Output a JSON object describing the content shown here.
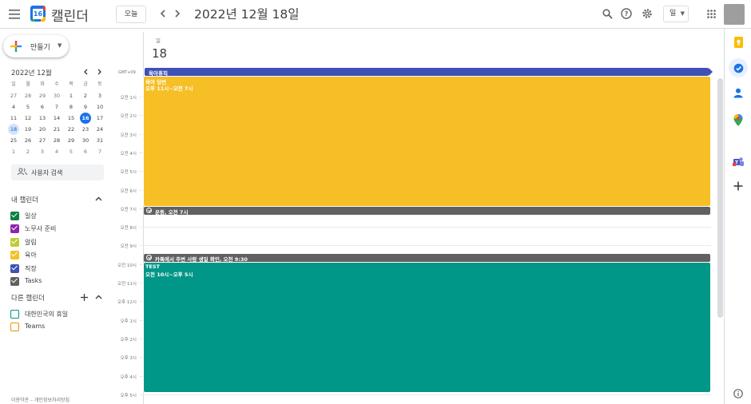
{
  "header": {
    "app_title": "캘린더",
    "logo_day": "16",
    "today_button": "오늘",
    "date_title": "2022년 12월 18일",
    "view_select": "일"
  },
  "sidebar": {
    "create_label": "만들기",
    "mini_calendar": {
      "title": "2022년 12월",
      "weekdays": [
        "일",
        "월",
        "화",
        "수",
        "목",
        "금",
        "토"
      ],
      "weeks": [
        [
          "27",
          "28",
          "29",
          "30",
          "1",
          "2",
          "3"
        ],
        [
          "4",
          "5",
          "6",
          "7",
          "8",
          "9",
          "10"
        ],
        [
          "11",
          "12",
          "13",
          "14",
          "15",
          "16",
          "17"
        ],
        [
          "18",
          "19",
          "20",
          "21",
          "22",
          "23",
          "24"
        ],
        [
          "25",
          "26",
          "27",
          "28",
          "29",
          "30",
          "31"
        ],
        [
          "1",
          "2",
          "3",
          "4",
          "5",
          "6",
          "7"
        ]
      ],
      "today": "16",
      "selected": "18"
    },
    "search_users": "사용자 검색",
    "my_calendars_title": "내 캘린더",
    "my_calendars": [
      {
        "label": "일상",
        "color": "#0b8043"
      },
      {
        "label": "노무사 준비",
        "color": "#8e24aa"
      },
      {
        "label": "알림",
        "color": "#c0ca33"
      },
      {
        "label": "육아",
        "color": "#f6bf26"
      },
      {
        "label": "직장",
        "color": "#3f51b5"
      },
      {
        "label": "Tasks",
        "color": "#616161"
      }
    ],
    "other_calendars_title": "다른 캘린더",
    "other_calendars": [
      {
        "label": "대한민국의 휴일",
        "color": "#009688"
      },
      {
        "label": "Teams",
        "color": "#f09300"
      }
    ],
    "footer": "이용약관 – 개인정보처리방침"
  },
  "day_view": {
    "day_name": "일",
    "day_number": "18",
    "timezone": "GMT+09",
    "hours": [
      "오전 1시",
      "오전 2시",
      "오전 3시",
      "오전 4시",
      "오전 5시",
      "오전 6시",
      "오전 7시",
      "오전 8시",
      "오전 9시",
      "오전 10시",
      "오전 11시",
      "오후 12시",
      "오후 1시",
      "오후 2시",
      "오후 3시",
      "오후 4시",
      "오후 5시"
    ],
    "allday_event": {
      "title": "육아휴직",
      "color": "#3f51b5"
    },
    "events": [
      {
        "title": "육아 당번",
        "time": "오후 11시~오전 7시",
        "color": "#f6bf26"
      },
      {
        "title": "TEST",
        "time": "오전 10시~오후 5시",
        "color": "#009688"
      }
    ],
    "tasks": [
      {
        "label": "운동, 오전 7시"
      },
      {
        "label": "카톡에서 주변 사람 생일 확인, 오전 9:30"
      }
    ]
  },
  "rail": {
    "icons": [
      "keep-icon",
      "tasks-icon",
      "contacts-icon",
      "maps-icon",
      "teams-icon",
      "add-icon",
      "info-icon"
    ]
  }
}
